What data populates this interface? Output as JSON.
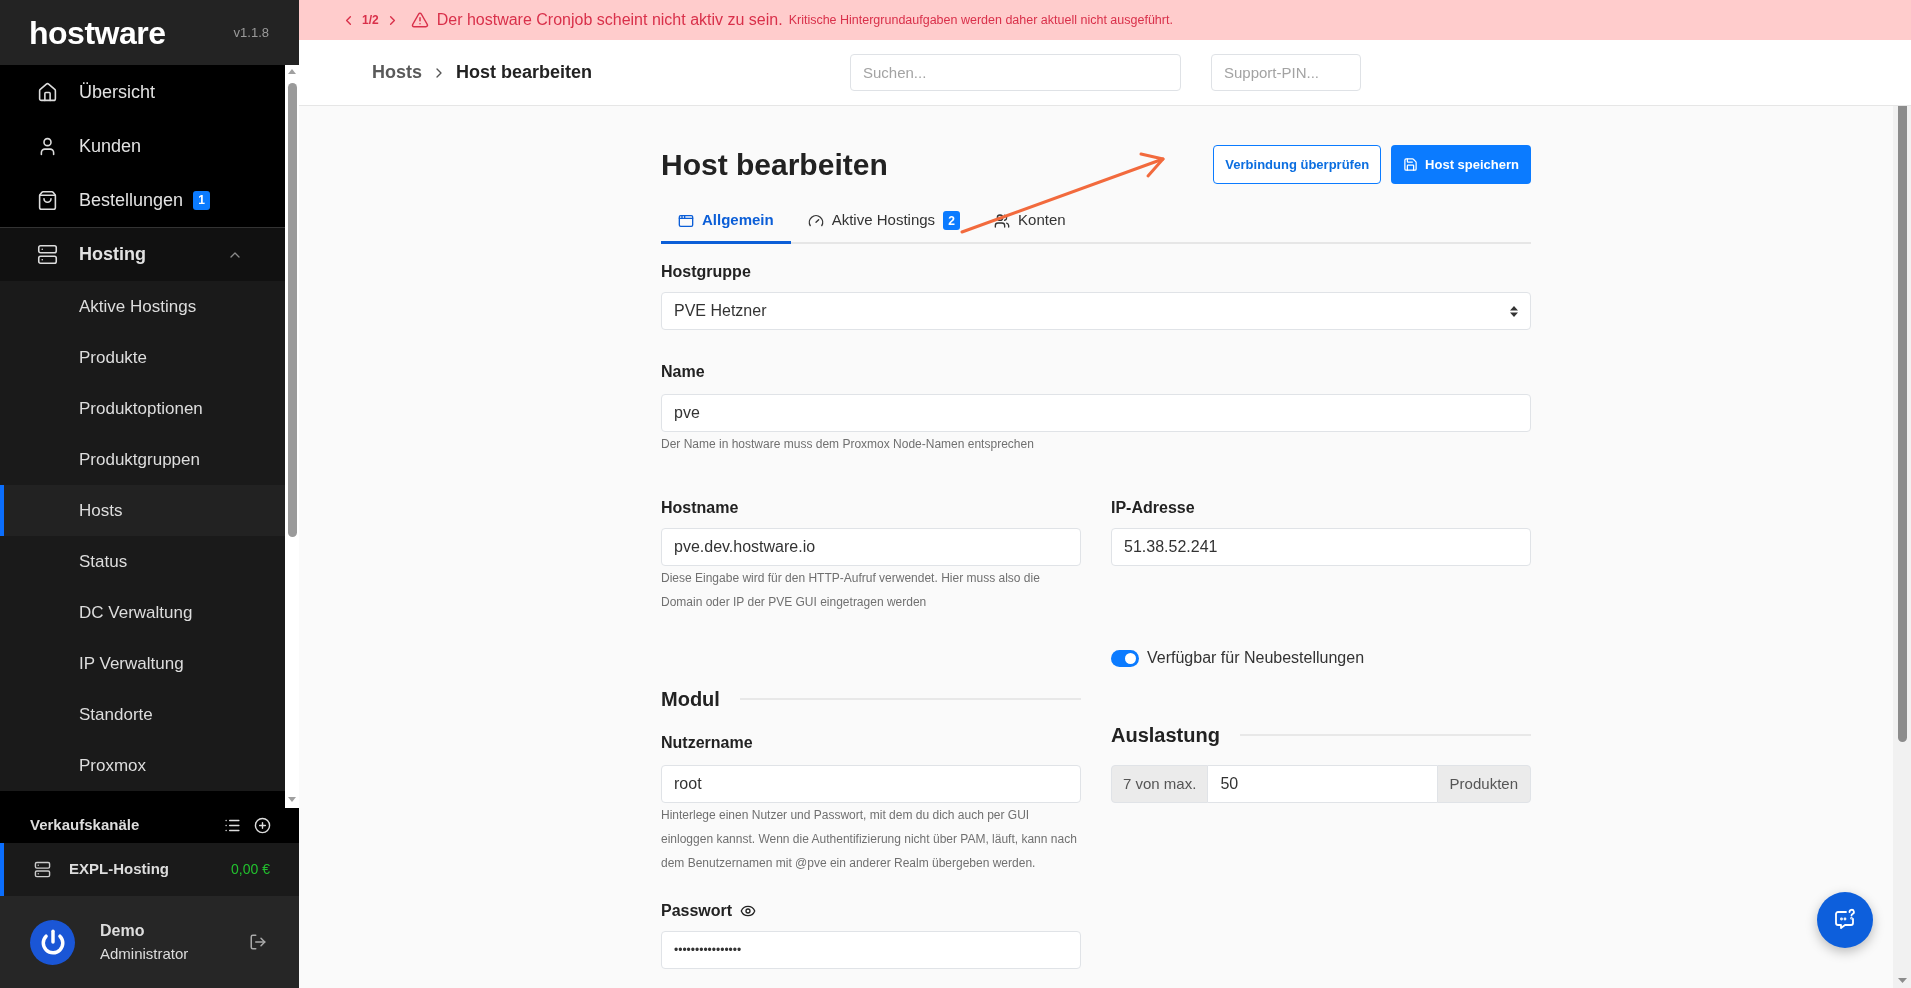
{
  "sidebar": {
    "logo": "hostware",
    "version": "v1.1.8",
    "nav": [
      {
        "label": "Übersicht",
        "selected": false
      },
      {
        "label": "Kunden",
        "selected": false
      },
      {
        "label": "Bestellungen",
        "badge": "1",
        "selected": false
      },
      {
        "label": "Hosting",
        "selected": false,
        "expanded": true,
        "children": [
          {
            "label": "Aktive Hostings",
            "selected": false
          },
          {
            "label": "Produkte",
            "selected": false
          },
          {
            "label": "Produktoptionen",
            "selected": false
          },
          {
            "label": "Produktgruppen",
            "selected": false
          },
          {
            "label": "Hosts",
            "selected": true
          },
          {
            "label": "Status",
            "selected": false
          },
          {
            "label": "DC Verwaltung",
            "selected": false
          },
          {
            "label": "IP Verwaltung",
            "selected": false
          },
          {
            "label": "Standorte",
            "selected": false
          },
          {
            "label": "Proxmox",
            "selected": false
          }
        ]
      }
    ],
    "sales_channels": {
      "title": "Verkaufskanäle",
      "items": [
        {
          "name": "EXPL-Hosting",
          "balance": "0,00 €",
          "selected": true
        }
      ]
    },
    "user": {
      "name": "Demo",
      "role": "Administrator"
    }
  },
  "banner": {
    "page": "1/2",
    "message": "Der hostware Cronjob scheint nicht aktiv zu sein.",
    "detail": "Kritische Hintergrundaufgaben werden daher aktuell nicht ausgeführt."
  },
  "header": {
    "breadcrumb": [
      {
        "label": "Hosts"
      },
      {
        "label": "Host bearbeiten"
      }
    ],
    "search": {
      "placeholder": "Suchen..."
    },
    "support_pin": {
      "placeholder": "Support-PIN..."
    }
  },
  "page": {
    "title": "Host bearbeiten",
    "actions": [
      {
        "label": "Verbindung überprüfen",
        "kind": "outline"
      },
      {
        "label": "Host speichern",
        "kind": "primary"
      }
    ]
  },
  "tabs": [
    {
      "label": "Allgemein",
      "selected": true
    },
    {
      "label": "Aktive Hostings",
      "badge": "2",
      "selected": false
    },
    {
      "label": "Konten",
      "selected": false
    }
  ],
  "form": {
    "hostgroup": {
      "label": "Hostgruppe",
      "value": "PVE Hetzner"
    },
    "name": {
      "label": "Name",
      "value": "pve",
      "hint": "Der Name in hostware muss dem Proxmox Node-Namen entsprechen"
    },
    "hostname": {
      "label": "Hostname",
      "value": "pve.dev.hostware.io",
      "hint": "Diese Eingabe wird für den HTTP-Aufruf verwendet. Hier muss also die Domain oder IP der PVE GUI eingetragen werden"
    },
    "ip": {
      "label": "IP-Adresse",
      "value": "51.38.52.241"
    },
    "available": {
      "label": "Verfügbar für Neubestellungen",
      "on": true
    },
    "module": {
      "title": "Modul",
      "username": {
        "label": "Nutzername",
        "value": "root",
        "hint": "Hinterlege einen Nutzer und Passwort, mit dem du dich auch per GUI einloggen kannst. Wenn die Authentifizierung nicht über PAM, läuft, kann nach dem Benutzernamen mit @pve ein anderer Realm übergeben werden."
      },
      "password": {
        "label": "Passwort",
        "value": "••••••••••••••••"
      }
    },
    "capacity": {
      "title": "Auslastung",
      "prefix": "7 von max.",
      "value": "50",
      "suffix": "Produkten"
    }
  }
}
